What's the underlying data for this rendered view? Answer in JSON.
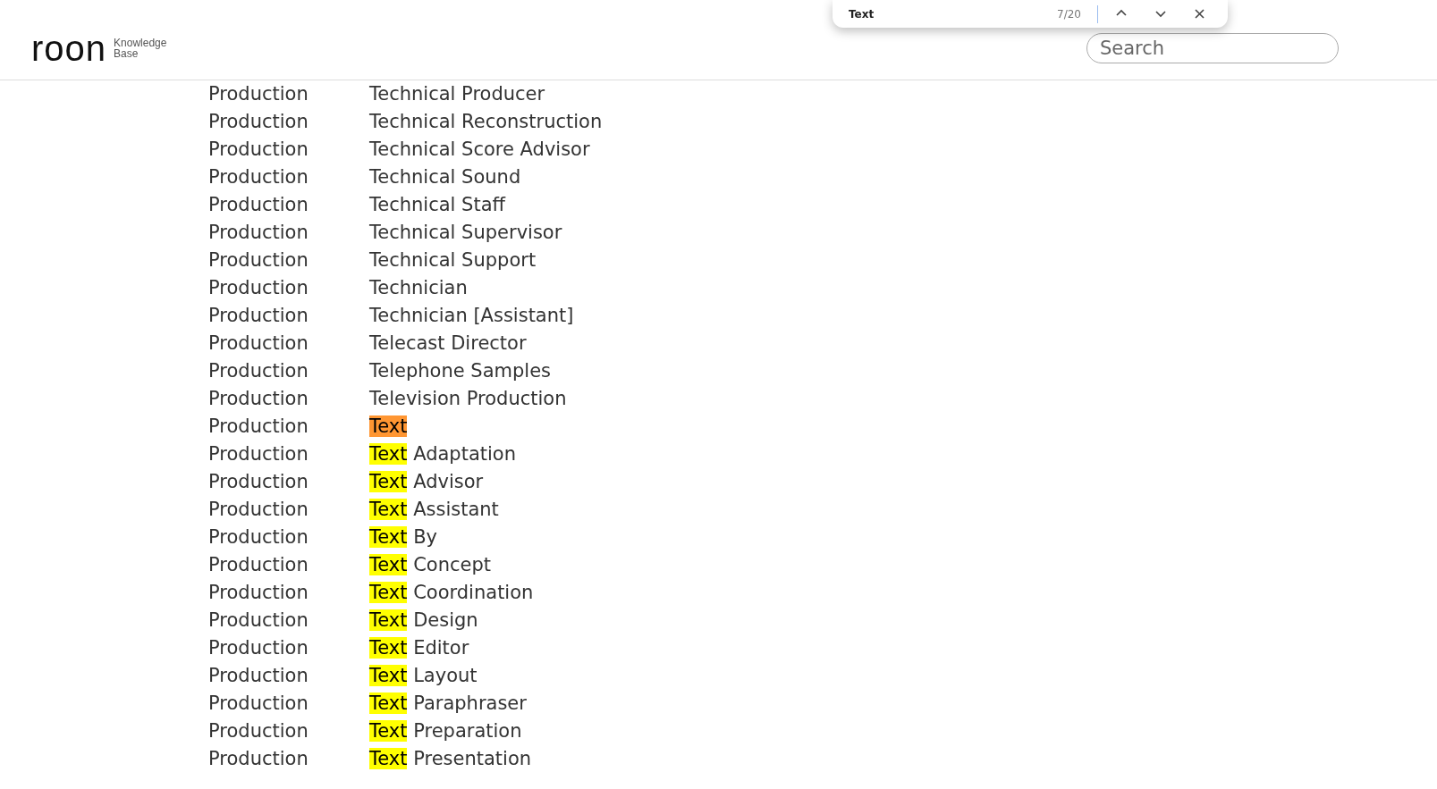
{
  "find_bar": {
    "query": "Text",
    "match_count": "7/20"
  },
  "header": {
    "logo": "roon",
    "subtitle_lines": [
      "Knowledge",
      "Base"
    ],
    "search": {
      "placeholder": "Search"
    }
  },
  "rows": [
    {
      "kind": "plain",
      "department": "Production",
      "title": "Technical Producer"
    },
    {
      "kind": "plain",
      "department": "Production",
      "title": "Technical Reconstruction"
    },
    {
      "kind": "plain",
      "department": "Production",
      "title": "Technical Score Advisor"
    },
    {
      "kind": "plain",
      "department": "Production",
      "title": "Technical Sound"
    },
    {
      "kind": "plain",
      "department": "Production",
      "title": "Technical Staff"
    },
    {
      "kind": "plain",
      "department": "Production",
      "title": "Technical Supervisor"
    },
    {
      "kind": "plain",
      "department": "Production",
      "title": "Technical Support"
    },
    {
      "kind": "plain",
      "department": "Production",
      "title": "Technician"
    },
    {
      "kind": "plain",
      "department": "Production",
      "title": "Technician [Assistant]"
    },
    {
      "kind": "plain",
      "department": "Production",
      "title": "Telecast Director"
    },
    {
      "kind": "plain",
      "department": "Production",
      "title": "Telephone Samples"
    },
    {
      "kind": "plain",
      "department": "Production",
      "title": "Television Production"
    },
    {
      "kind": "match",
      "department": "Production",
      "match": "Text",
      "rest": "",
      "current": true
    },
    {
      "kind": "match",
      "department": "Production",
      "match": "Text",
      "rest": "Adaptation",
      "current": false
    },
    {
      "kind": "match",
      "department": "Production",
      "match": "Text",
      "rest": "Advisor",
      "current": false
    },
    {
      "kind": "match",
      "department": "Production",
      "match": "Text",
      "rest": "Assistant",
      "current": false
    },
    {
      "kind": "match",
      "department": "Production",
      "match": "Text",
      "rest": "By",
      "current": false
    },
    {
      "kind": "match",
      "department": "Production",
      "match": "Text",
      "rest": "Concept",
      "current": false
    },
    {
      "kind": "match",
      "department": "Production",
      "match": "Text",
      "rest": "Coordination",
      "current": false
    },
    {
      "kind": "match",
      "department": "Production",
      "match": "Text",
      "rest": "Design",
      "current": false
    },
    {
      "kind": "match",
      "department": "Production",
      "match": "Text",
      "rest": "Editor",
      "current": false
    },
    {
      "kind": "match",
      "department": "Production",
      "match": "Text",
      "rest": "Layout",
      "current": false
    },
    {
      "kind": "match",
      "department": "Production",
      "match": "Text",
      "rest": "Paraphraser",
      "current": false
    },
    {
      "kind": "match",
      "department": "Production",
      "match": "Text",
      "rest": "Preparation",
      "current": false
    },
    {
      "kind": "match",
      "department": "Production",
      "match": "Text",
      "rest": "Presentation",
      "current": false
    }
  ]
}
